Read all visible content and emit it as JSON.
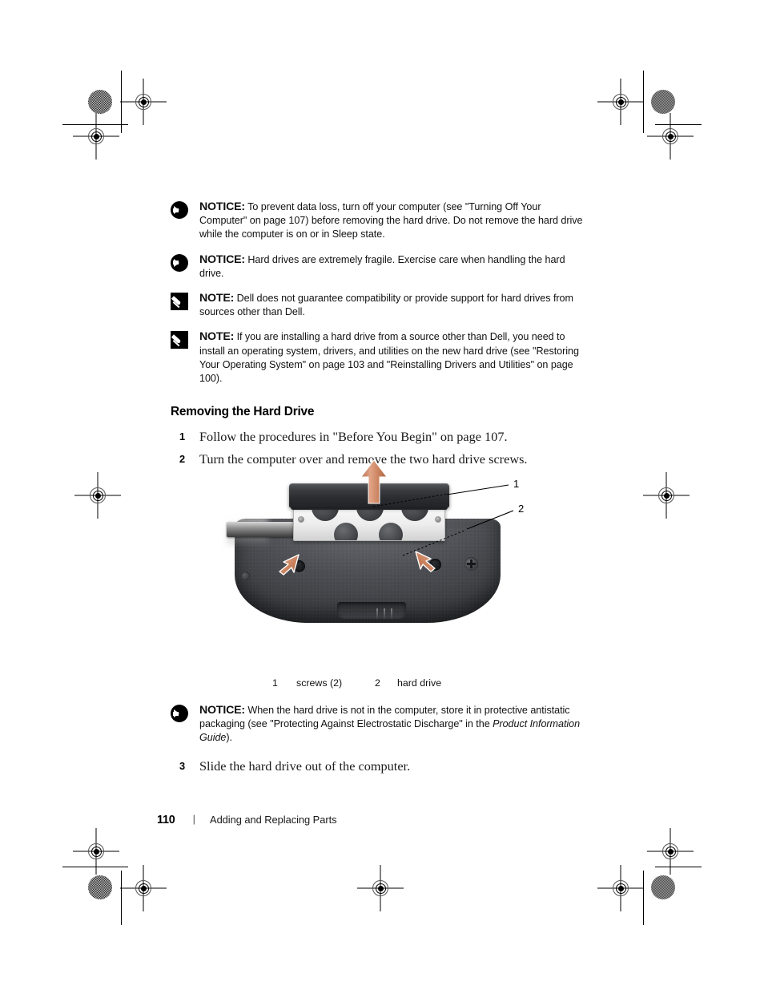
{
  "document": {
    "admonitions": [
      {
        "icon": "notice-arrow-icon",
        "keyword": "NOTICE:",
        "text": " To prevent data loss, turn off your computer (see \"Turning Off Your Computer\" on page 107) before removing the hard drive. Do not remove the hard drive while the computer is on or in Sleep state."
      },
      {
        "icon": "notice-arrow-icon",
        "keyword": "NOTICE:",
        "text": " Hard drives are extremely fragile. Exercise care when handling the hard drive."
      },
      {
        "icon": "note-pencil-icon",
        "keyword": "NOTE:",
        "text": " Dell does not guarantee compatibility or provide support for hard drives from sources other than Dell."
      },
      {
        "icon": "note-pencil-icon",
        "keyword": "NOTE:",
        "text": " If you are installing a hard drive from a source other than Dell, you need to install an operating system, drivers, and utilities on the new hard drive (see \"Restoring Your Operating System\" on page 103 and \"Reinstalling Drivers and Utilities\" on page 100)."
      }
    ],
    "section_heading": "Removing the Hard Drive",
    "steps": [
      {
        "num": "1",
        "text": "Follow the procedures in \"Before You Begin\" on page 107."
      },
      {
        "num": "2",
        "text": "Turn the computer over and remove the two hard drive screws."
      }
    ],
    "figure": {
      "callouts": [
        {
          "num": "1",
          "label": "screws (2)"
        },
        {
          "num": "2",
          "label": "hard drive"
        }
      ],
      "arrow_color": "#c9805c",
      "chassis_color": "#3b3d41"
    },
    "legend": {
      "item1_num": "1",
      "item1_text": "screws (2)",
      "item2_num": "2",
      "item2_text": "hard drive"
    },
    "notice_after_figure": {
      "icon": "notice-arrow-icon",
      "keyword": "NOTICE:",
      "text_before_italic": " When the hard drive is not in the computer, store it in protective antistatic packaging (see \"Protecting Against Electrostatic Discharge\" in the ",
      "italic_text": "Product Information Guide",
      "text_after_italic": ")."
    },
    "step3": {
      "num": "3",
      "text": "Slide the hard drive out of the computer."
    },
    "footer": {
      "page_number": "110",
      "separator": "|",
      "chapter_title": "Adding and Replacing Parts"
    }
  }
}
